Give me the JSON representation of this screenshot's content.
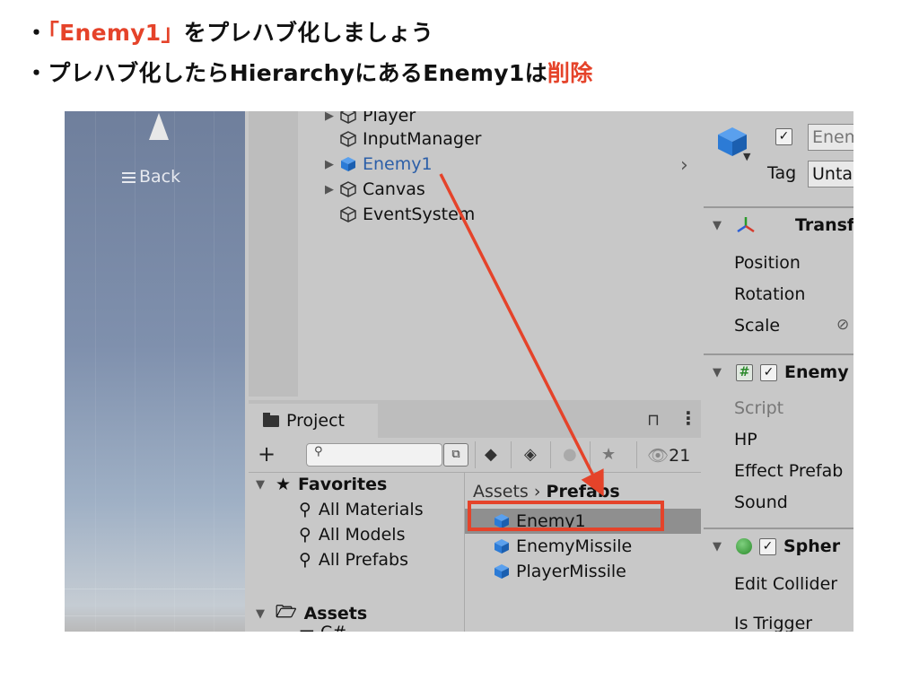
{
  "slide": {
    "bullet1": {
      "mark": "・",
      "red": "「Enemy1」",
      "rest": "をプレハブ化しましょう"
    },
    "bullet2": {
      "mark": "・",
      "text": "プレハブ化したらHierarchyにあるEnemy1は",
      "red": "削除"
    }
  },
  "colors": {
    "accent_red": "#e5432a",
    "prefab_blue": "#2c7bd6",
    "panel_bg": "#c8c8c8"
  },
  "scene": {
    "back_label": "Back"
  },
  "hierarchy": {
    "items": [
      {
        "label": "Player",
        "expandable": true,
        "prefab": false
      },
      {
        "label": "InputManager",
        "expandable": false,
        "prefab": false
      },
      {
        "label": "Enemy1",
        "expandable": true,
        "prefab": true
      },
      {
        "label": "Canvas",
        "expandable": true,
        "prefab": false
      },
      {
        "label": "EventSystem",
        "expandable": false,
        "prefab": false
      }
    ]
  },
  "project": {
    "tab_label": "Project",
    "hidden_count": "21",
    "favorites_label": "Favorites",
    "favorites": [
      "All Materials",
      "All Models",
      "All Prefabs"
    ],
    "assets_label": "Assets",
    "assets_child": "C#",
    "breadcrumb": {
      "root": "Assets",
      "current": "Prefabs"
    },
    "files": [
      {
        "label": "Enemy1",
        "selected": true
      },
      {
        "label": "EnemyMissile",
        "selected": false
      },
      {
        "label": "PlayerMissile",
        "selected": false
      }
    ]
  },
  "inspector": {
    "name_value": "Enem",
    "tag_label": "Tag",
    "tag_value": "Unta",
    "transform_label": "Transf",
    "transform_fields": [
      "Position",
      "Rotation",
      "Scale"
    ],
    "script_component": "Enemy",
    "script_fields": [
      "Script",
      "HP",
      "Effect Prefab",
      "Sound"
    ],
    "collider_component": "Spher",
    "collider_fields": [
      "Edit Collider",
      "Is Trigger"
    ]
  }
}
